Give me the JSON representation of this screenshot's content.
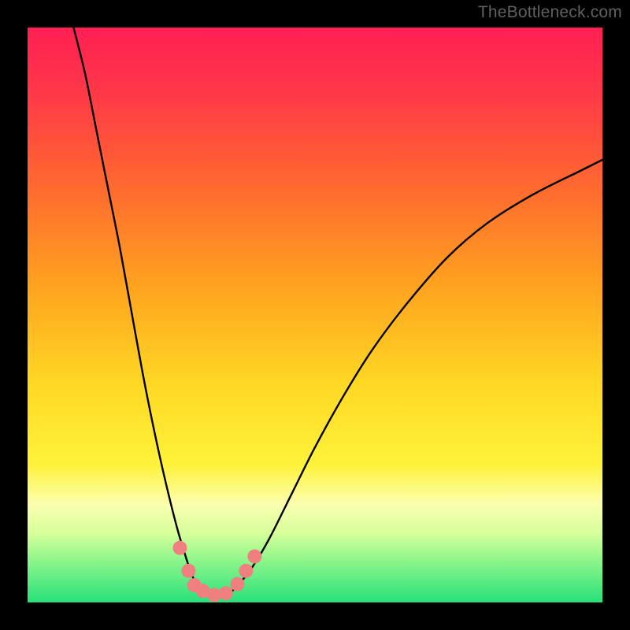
{
  "watermark": "TheBottleneck.com",
  "chart_data": {
    "type": "line",
    "title": "",
    "xlabel": "",
    "ylabel": "",
    "xlim": [
      0,
      100
    ],
    "ylim": [
      0,
      100
    ],
    "background_gradient": {
      "stops": [
        {
          "y_pct": 0,
          "color": "#ff1f54"
        },
        {
          "y_pct": 12,
          "color": "#ff3a47"
        },
        {
          "y_pct": 28,
          "color": "#ff6a2f"
        },
        {
          "y_pct": 45,
          "color": "#ffa31f"
        },
        {
          "y_pct": 62,
          "color": "#ffd824"
        },
        {
          "y_pct": 76,
          "color": "#fff23a"
        },
        {
          "y_pct": 83,
          "color": "#fbffb0"
        },
        {
          "y_pct": 88,
          "color": "#d6ff9a"
        },
        {
          "y_pct": 93,
          "color": "#89f58a"
        },
        {
          "y_pct": 100,
          "color": "#28e07a"
        }
      ]
    },
    "series": [
      {
        "name": "bottleneck-curve",
        "comment": "Estimated (x_pct, y_pct_from_top) vertices of the black V-shaped curve; y=100 is top of plot",
        "points": [
          [
            8,
            100
          ],
          [
            10,
            92
          ],
          [
            12,
            82
          ],
          [
            14,
            72
          ],
          [
            16,
            62
          ],
          [
            18,
            51
          ],
          [
            20,
            40
          ],
          [
            22,
            30
          ],
          [
            24,
            21
          ],
          [
            26,
            13
          ],
          [
            27.5,
            8
          ],
          [
            28.5,
            5
          ],
          [
            29.5,
            3
          ],
          [
            31,
            1.5
          ],
          [
            33,
            1
          ],
          [
            35,
            1.5
          ],
          [
            37,
            3.5
          ],
          [
            39,
            6
          ],
          [
            42,
            11
          ],
          [
            46,
            19
          ],
          [
            50,
            27
          ],
          [
            55,
            36
          ],
          [
            60,
            44
          ],
          [
            66,
            52
          ],
          [
            73,
            60
          ],
          [
            80,
            66
          ],
          [
            88,
            71
          ],
          [
            96,
            75
          ],
          [
            100,
            77
          ]
        ]
      },
      {
        "name": "highlight-markers",
        "comment": "salmon/pink dot markers along trough region (x_pct, y_pct_from_top)",
        "color": "#f08080",
        "points": [
          [
            26.5,
            9.5
          ],
          [
            28,
            5.5
          ],
          [
            29,
            3
          ],
          [
            30.5,
            2
          ],
          [
            32.5,
            1.3
          ],
          [
            34.5,
            1.6
          ],
          [
            36.5,
            3.2
          ],
          [
            38,
            5.5
          ],
          [
            39.5,
            8
          ]
        ]
      }
    ]
  }
}
